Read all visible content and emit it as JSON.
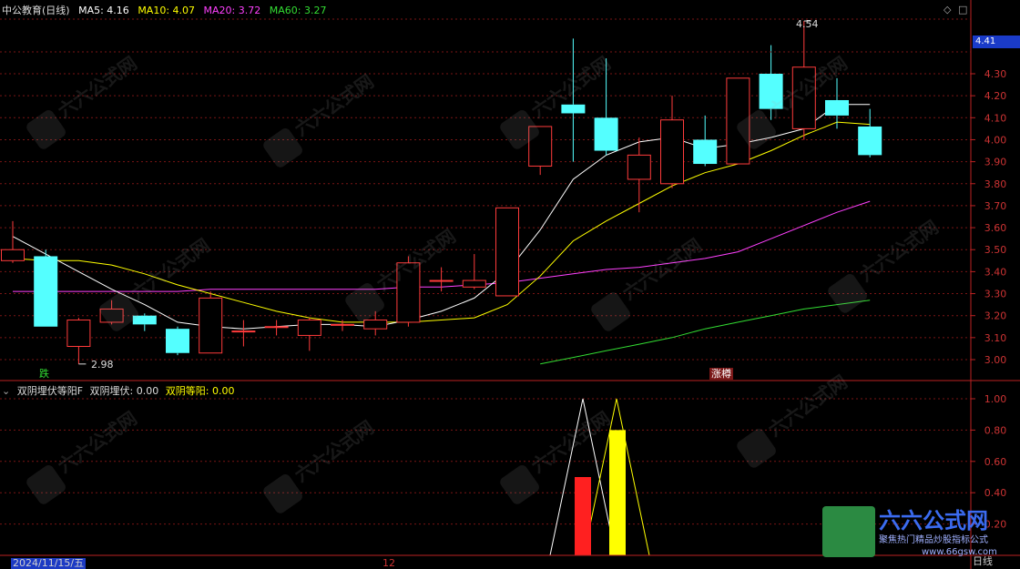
{
  "header": {
    "title": "中公教育(日线)",
    "ma5_label": "MA5: 4.16",
    "ma10_label": "MA10: 4.07",
    "ma20_label": "MA20: 3.72",
    "ma60_label": "MA60: 3.27"
  },
  "indicator": {
    "name": "双阴埋伏等阳F",
    "v1_label": "双阴埋伏: 0.00",
    "v2_label": "双阴等阳: 0.00"
  },
  "colors": {
    "up": "#ff3b3b",
    "down": "#54ffff",
    "ma5": "#ffffff",
    "ma10": "#ffff00",
    "ma20": "#ff40ff",
    "ma60": "#33dd33",
    "grid": "#7a1515",
    "axis": "#bb2222"
  },
  "price_axis": {
    "ticks": [
      "4.41",
      "4.30",
      "4.20",
      "4.10",
      "4.00",
      "3.90",
      "3.80",
      "3.70",
      "3.60",
      "3.50",
      "3.40",
      "3.30",
      "3.20",
      "3.10",
      "3.00"
    ],
    "current": "4.41"
  },
  "indicator_axis": {
    "ticks": [
      "1.00",
      "0.80",
      "0.60",
      "0.40",
      "0.20"
    ]
  },
  "annotations": {
    "high_label": "4.54",
    "low_label": "2.98",
    "tag_fall": "跌",
    "tag_limit": "涨樽"
  },
  "candles": [
    {
      "o": 3.45,
      "c": 3.5,
      "h": 3.63,
      "l": 3.44
    },
    {
      "o": 3.47,
      "c": 3.15,
      "h": 3.5,
      "l": 3.15
    },
    {
      "o": 3.06,
      "c": 3.18,
      "h": 3.19,
      "l": 2.98
    },
    {
      "o": 3.17,
      "c": 3.23,
      "h": 3.27,
      "l": 3.16
    },
    {
      "o": 3.2,
      "c": 3.16,
      "h": 3.21,
      "l": 3.13
    },
    {
      "o": 3.14,
      "c": 3.03,
      "h": 3.15,
      "l": 3.02
    },
    {
      "o": 3.03,
      "c": 3.28,
      "h": 3.31,
      "l": 3.03
    },
    {
      "o": 3.13,
      "c": 3.13,
      "h": 3.18,
      "l": 3.06
    },
    {
      "o": 3.15,
      "c": 3.15,
      "h": 3.18,
      "l": 3.11
    },
    {
      "o": 3.11,
      "c": 3.18,
      "h": 3.19,
      "l": 3.04
    },
    {
      "o": 3.16,
      "c": 3.16,
      "h": 3.18,
      "l": 3.13
    },
    {
      "o": 3.14,
      "c": 3.18,
      "h": 3.22,
      "l": 3.11
    },
    {
      "o": 3.17,
      "c": 3.44,
      "h": 3.47,
      "l": 3.15
    },
    {
      "o": 3.36,
      "c": 3.36,
      "h": 3.42,
      "l": 3.31
    },
    {
      "o": 3.33,
      "c": 3.36,
      "h": 3.48,
      "l": 3.32
    },
    {
      "o": 3.29,
      "c": 3.69,
      "h": 3.69,
      "l": 3.29
    },
    {
      "o": 3.88,
      "c": 4.06,
      "h": 4.06,
      "l": 3.84
    },
    {
      "o": 4.16,
      "c": 4.12,
      "h": 4.46,
      "l": 3.9
    },
    {
      "o": 4.1,
      "c": 3.95,
      "h": 4.37,
      "l": 3.93
    },
    {
      "o": 3.82,
      "c": 3.93,
      "h": 4.01,
      "l": 3.67
    },
    {
      "o": 3.8,
      "c": 4.09,
      "h": 4.2,
      "l": 3.78
    },
    {
      "o": 4.0,
      "c": 3.89,
      "h": 4.11,
      "l": 3.88
    },
    {
      "o": 3.89,
      "c": 4.28,
      "h": 4.28,
      "l": 3.89
    },
    {
      "o": 4.3,
      "c": 4.14,
      "h": 4.43,
      "l": 4.09
    },
    {
      "o": 4.05,
      "c": 4.33,
      "h": 4.54,
      "l": 4.0
    },
    {
      "o": 4.18,
      "c": 4.11,
      "h": 4.28,
      "l": 4.05
    },
    {
      "o": 4.06,
      "c": 3.93,
      "h": 4.14,
      "l": 3.92
    }
  ],
  "ma5": [
    3.56,
    3.48,
    3.4,
    3.32,
    3.25,
    3.17,
    3.15,
    3.14,
    3.15,
    3.16,
    3.16,
    3.15,
    3.18,
    3.22,
    3.28,
    3.4,
    3.59,
    3.82,
    3.93,
    3.99,
    4.01,
    3.96,
    3.98,
    4.01,
    4.05,
    4.16,
    4.16
  ],
  "ma10": [
    3.46,
    3.45,
    3.45,
    3.43,
    3.39,
    3.34,
    3.3,
    3.26,
    3.22,
    3.19,
    3.17,
    3.17,
    3.17,
    3.18,
    3.19,
    3.25,
    3.38,
    3.54,
    3.63,
    3.71,
    3.79,
    3.85,
    3.89,
    3.95,
    4.02,
    4.08,
    4.07
  ],
  "ma20": [
    3.31,
    3.31,
    3.31,
    3.31,
    3.31,
    3.31,
    3.32,
    3.32,
    3.32,
    3.32,
    3.32,
    3.32,
    3.33,
    3.33,
    3.34,
    3.35,
    3.37,
    3.39,
    3.41,
    3.42,
    3.44,
    3.46,
    3.49,
    3.55,
    3.61,
    3.67,
    3.72
  ],
  "ma60": [
    null,
    null,
    null,
    null,
    null,
    null,
    null,
    null,
    null,
    null,
    null,
    null,
    null,
    null,
    null,
    null,
    2.98,
    3.01,
    3.04,
    3.07,
    3.1,
    3.14,
    3.17,
    3.2,
    3.23,
    3.25,
    3.27
  ],
  "signals": {
    "red_bar_value": 0.5,
    "yellow_bar_value": 0.8,
    "red_triangle_value": 1.0,
    "yellow_triangle_value": 1.0
  },
  "footer": {
    "date": "2024/11/15/五",
    "mid_label": "12",
    "period": "日线"
  },
  "watermark": {
    "brand": "六六公式网",
    "slogan": "聚焦热门精品炒股指标公式",
    "url": "www.66gsw.com"
  }
}
